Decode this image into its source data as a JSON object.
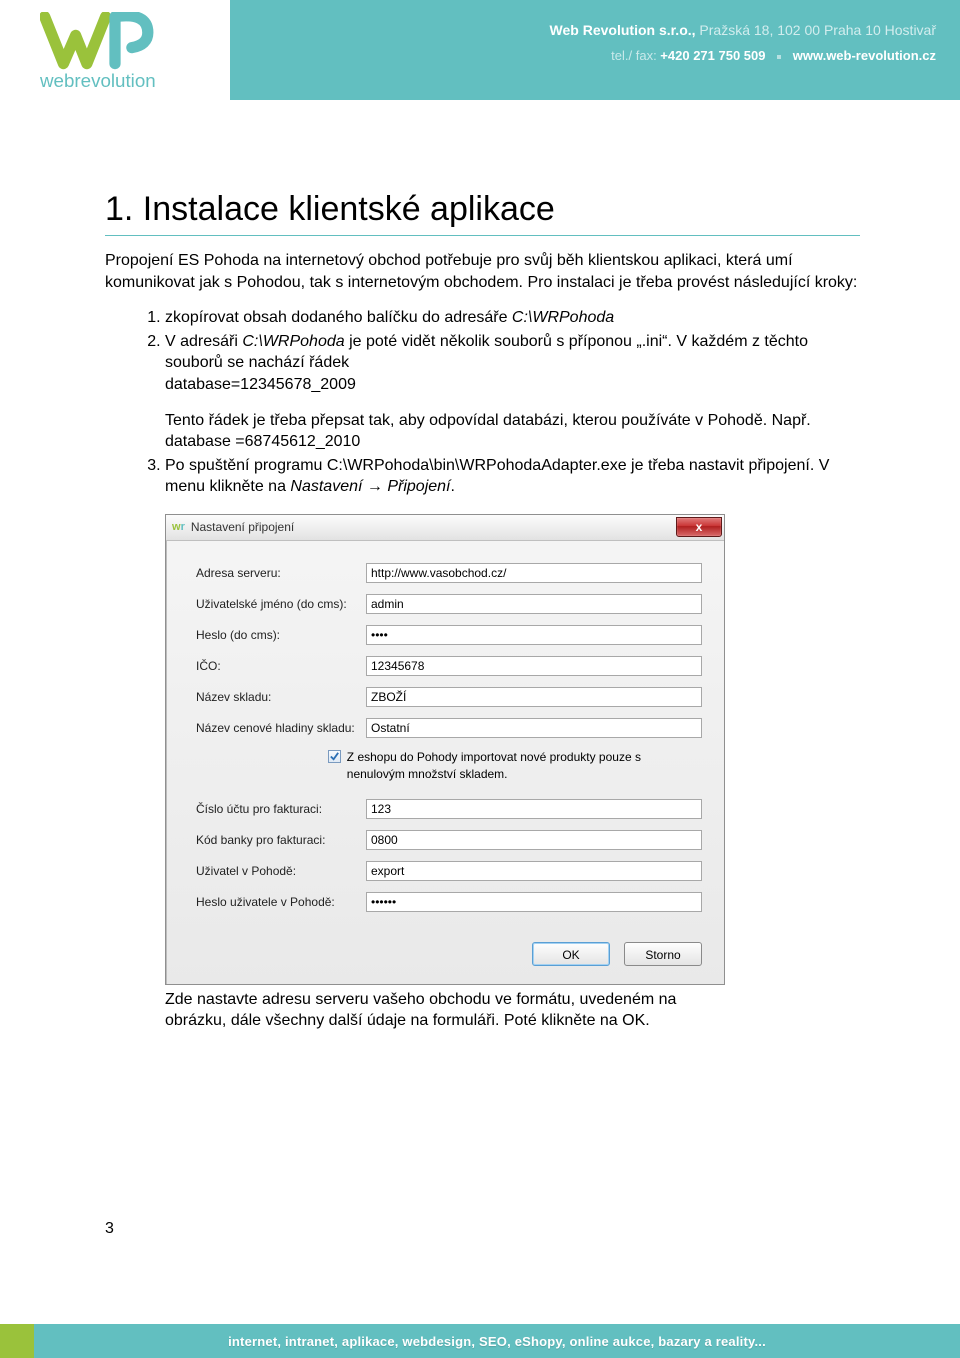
{
  "header": {
    "company_bold": "Web Revolution s.r.o.,",
    "company_rest": " Pražská 18, 102 00 Praha 10 Hostivař",
    "tel_label": "tel./ fax: ",
    "tel_num": "+420 271 750 509",
    "website": "www.web-revolution.cz",
    "logo_text": "webrevolution"
  },
  "title": "1.  Instalace klientské aplikace",
  "intro": "Propojení ES Pohoda na internetový obchod potřebuje pro svůj běh klientskou aplikaci, která umí komunikovat jak s Pohodou, tak s internetovým obchodem. Pro instalaci je třeba provést následující kroky:",
  "steps": {
    "s1_a": "zkopírovat obsah dodaného balíčku do adresáře ",
    "s1_b": "C:\\WRPohoda",
    "s2_a": "V adresáři ",
    "s2_b": "C:\\WRPohoda",
    "s2_c": " je poté vidět několik souborů s příponou „.ini“. V každém z těchto souborů se nachází řádek",
    "s2_d": "database=12345678_2009",
    "s2_e": "Tento řádek je třeba přepsat tak, aby odpovídal databázi, kterou používáte v Pohodě. Např.",
    "s2_f": "database =68745612_2010",
    "s3_a": "Po spuštění programu C:\\WRPohoda\\bin\\WRPohodaAdapter.exe je třeba nastavit připojení. V menu klikněte na ",
    "s3_b": "Nastavení → Připojení",
    "s3_c": "."
  },
  "dialog": {
    "title": "Nastavení připojení",
    "close_symbol": "x",
    "fields": {
      "adresa_serveru": {
        "label": "Adresa serveru:",
        "value": "http://www.vasobchod.cz/"
      },
      "uzivatel_cms": {
        "label": "Uživatelské jméno (do cms):",
        "value": "admin"
      },
      "heslo_cms": {
        "label": "Heslo (do cms):",
        "value": "••••"
      },
      "ico": {
        "label": "IČO:",
        "value": "12345678"
      },
      "nazev_skladu": {
        "label": "Název skladu:",
        "value": "ZBOŽÍ"
      },
      "cen_hladina": {
        "label": "Název cenové hladiny skladu:",
        "value": "Ostatní"
      },
      "checkbox_text": "Z eshopu do Pohody importovat nové produkty pouze s nenulovým množství skladem.",
      "cislo_uctu": {
        "label": "Číslo účtu pro fakturaci:",
        "value": "123"
      },
      "kod_banky": {
        "label": "Kód banky pro fakturaci:",
        "value": "0800"
      },
      "uzivatel_pohoda": {
        "label": "Uživatel v Pohodě:",
        "value": "export"
      },
      "heslo_pohoda": {
        "label": "Heslo uživatele v Pohodě:",
        "value": "••••••"
      }
    },
    "ok": "OK",
    "storno": "Storno"
  },
  "after_dialog": "Zde nastavte adresu serveru vašeho obchodu ve formátu, uvedeném na obrázku, dále všechny další údaje na formuláři. Poté klikněte na OK.",
  "page_number": "3",
  "footer": "internet, intranet, aplikace, webdesign, SEO, eShopy, online aukce, bazary a reality..."
}
